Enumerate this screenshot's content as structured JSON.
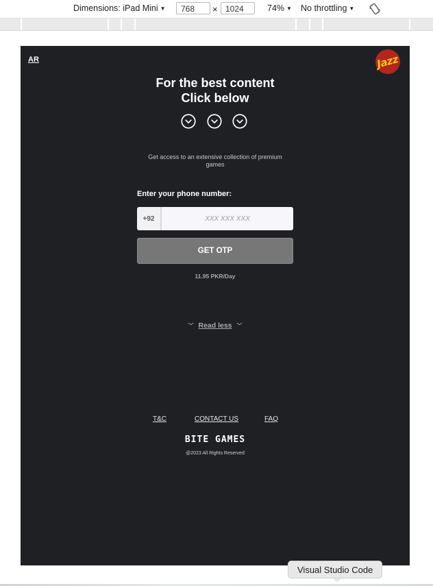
{
  "devtools": {
    "dimensions_label": "Dimensions: iPad Mini",
    "width": "768",
    "times": "×",
    "height": "1024",
    "zoom": "74%",
    "throttling": "No throttling"
  },
  "page": {
    "lang_toggle": "AR",
    "brand_logo_text": "Jazz",
    "headline_line1": "For the best content",
    "headline_line2": "Click below",
    "subtext": "Get access to an extensive collection of premium games",
    "phone_label": "Enter your phone number:",
    "phone_prefix": "+92",
    "phone_placeholder": "XXX XXX XXX",
    "phone_value": "",
    "otp_button": "GET OTP",
    "price": "11.95 PKR/Day",
    "read_less": "Read less",
    "footer": {
      "tnc": "T&C",
      "contact": "CONTACT US",
      "faq": "FAQ",
      "brand": "BITE GAMES",
      "copyright": "@2023 All Rights Reserved"
    }
  },
  "os": {
    "tooltip": "Visual Studio Code"
  },
  "colors": {
    "page_bg": "#1f2024",
    "button_bg": "#777777",
    "brand_red": "#b3261e",
    "brand_yellow": "#f4c51a"
  }
}
